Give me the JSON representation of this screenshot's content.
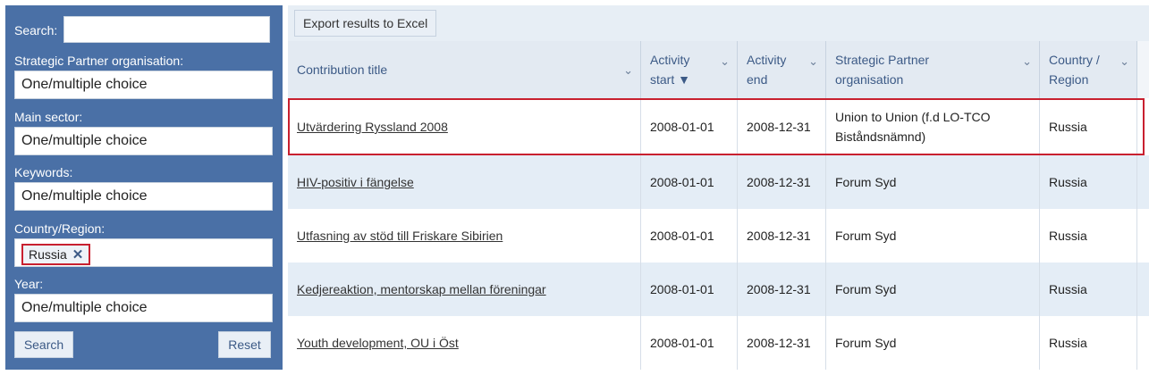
{
  "sidebar": {
    "search_label": "Search:",
    "search_value": "",
    "partner_label": "Strategic Partner organisation:",
    "partner_value": "One/multiple choice",
    "sector_label": "Main sector:",
    "sector_value": "One/multiple choice",
    "keywords_label": "Keywords:",
    "keywords_value": "One/multiple choice",
    "country_label": "Country/Region:",
    "country_tag": "Russia",
    "country_tag_remove_icon": "x-icon",
    "year_label": "Year:",
    "year_value": "One/multiple choice",
    "search_button": "Search",
    "reset_button": "Reset",
    "colors": {
      "background": "#4a70a6",
      "tag_highlight": "#c8202f"
    }
  },
  "toolbar": {
    "export_label": "Export results to Excel"
  },
  "table": {
    "headers": [
      {
        "label": "Contribution title"
      },
      {
        "label": "Activity start ▼"
      },
      {
        "label": "Activity end"
      },
      {
        "label": "Strategic Partner organisation"
      },
      {
        "label": "Country / Region"
      }
    ],
    "rows": [
      {
        "title": "Utvärdering Ryssland 2008",
        "start": "2008-01-01",
        "end": "2008-12-31",
        "partner": "Union to Union (f.d LO-TCO Biståndsnämnd)",
        "country": "Russia"
      },
      {
        "title": "HIV-positiv i fängelse",
        "start": "2008-01-01",
        "end": "2008-12-31",
        "partner": "Forum Syd",
        "country": "Russia"
      },
      {
        "title": "Utfasning av stöd till Friskare Sibirien",
        "start": "2008-01-01",
        "end": "2008-12-31",
        "partner": "Forum Syd",
        "country": "Russia"
      },
      {
        "title": "Kedjereaktion, mentorskap mellan föreningar",
        "start": "2008-01-01",
        "end": "2008-12-31",
        "partner": "Forum Syd",
        "country": "Russia"
      },
      {
        "title": "Youth development, OU i Öst",
        "start": "2008-01-01",
        "end": "2008-12-31",
        "partner": "Forum Syd",
        "country": "Russia"
      }
    ],
    "colors": {
      "row_alt": "#e4edf6",
      "row": "#ffffff",
      "highlight_border": "#c8202f"
    }
  }
}
